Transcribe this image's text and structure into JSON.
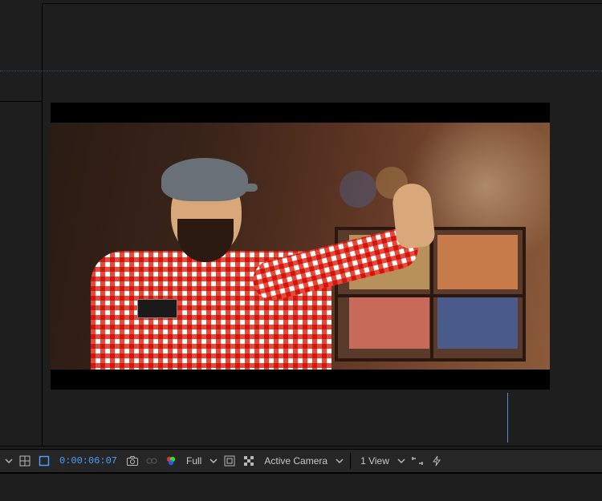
{
  "timecode": "0:00:06:07",
  "resolution": {
    "label": "Full"
  },
  "view3d": {
    "camera": "Active Camera",
    "viewcount": "1 View"
  }
}
